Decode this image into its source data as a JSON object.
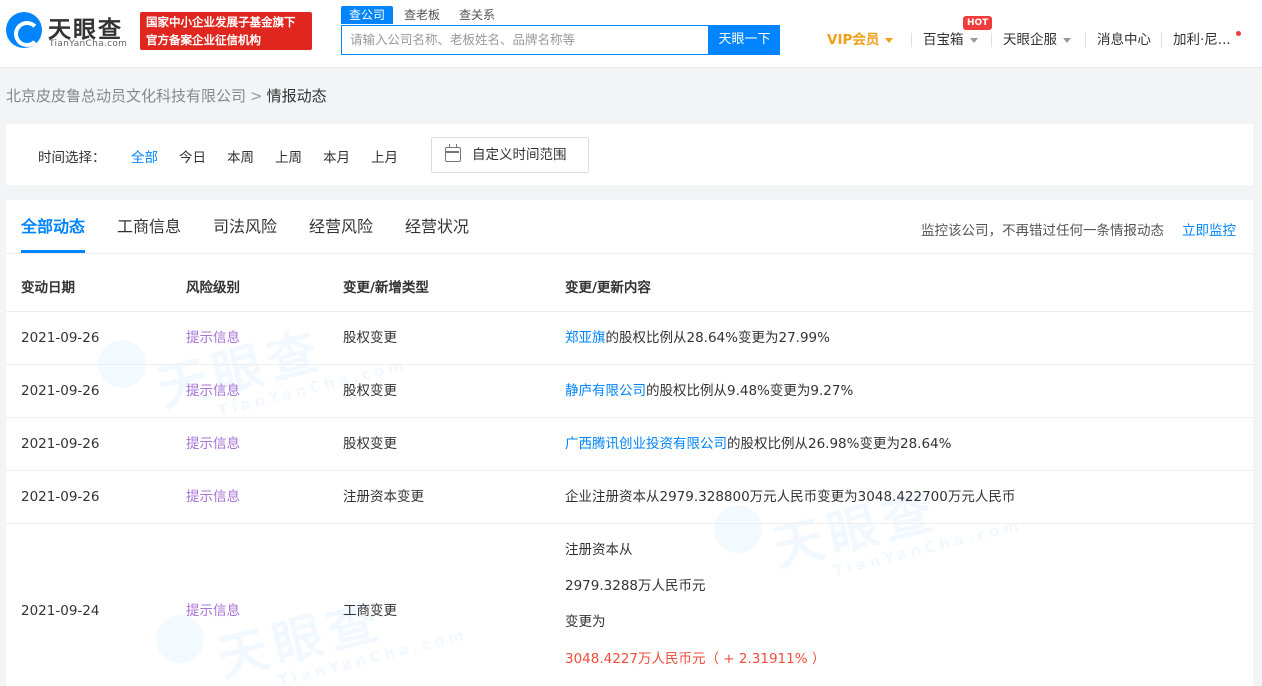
{
  "header": {
    "logo_text": "天眼查",
    "logo_sub": "TianYanCha.com",
    "badge_line1": "国家中小企业发展子基金旗下",
    "badge_line2": "官方备案企业征信机构",
    "search_tabs": [
      "查公司",
      "查老板",
      "查关系"
    ],
    "search_placeholder": "请输入公司名称、老板姓名、品牌名称等",
    "search_button": "天眼一下",
    "nav": {
      "vip": "VIP会员",
      "baibaoxiang": "百宝箱",
      "hot": "HOT",
      "qifu": "天眼企服",
      "messages": "消息中心",
      "user": "加利·尼..."
    }
  },
  "breadcrumb": {
    "company": "北京皮皮鲁总动员文化科技有限公司",
    "sep": ">",
    "current": "情报动态"
  },
  "filter": {
    "label": "时间选择：",
    "options": [
      "全部",
      "今日",
      "本周",
      "上周",
      "本月",
      "上月"
    ],
    "custom": "自定义时间范围"
  },
  "tabs": [
    "全部动态",
    "工商信息",
    "司法风险",
    "经营风险",
    "经营状况"
  ],
  "monitor": {
    "text": "监控该公司，不再错过任何一条情报动态",
    "link": "立即监控"
  },
  "table": {
    "headers": [
      "变动日期",
      "风险级别",
      "变更/新增类型",
      "变更/更新内容"
    ],
    "rows": [
      {
        "date": "2021-09-26",
        "risk": "提示信息",
        "type": "股权变更",
        "link": "郑亚旗",
        "rest": "的股权比例从28.64%变更为27.99%"
      },
      {
        "date": "2021-09-26",
        "risk": "提示信息",
        "type": "股权变更",
        "link": "静庐有限公司",
        "rest": "的股权比例从9.48%变更为9.27%"
      },
      {
        "date": "2021-09-26",
        "risk": "提示信息",
        "type": "股权变更",
        "link": "广西腾讯创业投资有限公司",
        "rest": "的股权比例从26.98%变更为28.64%"
      },
      {
        "date": "2021-09-26",
        "risk": "提示信息",
        "type": "注册资本变更",
        "link": "",
        "rest": "企业注册资本从2979.328800万元人民币变更为3048.422700万元人民币"
      }
    ],
    "last_row": {
      "date": "2021-09-24",
      "risk": "提示信息",
      "type": "工商变更",
      "line1": "注册资本从",
      "line2": "2979.3288万人民币元",
      "line3": "变更为",
      "line4": "3048.4227万人民币元（ + 2.31911% ）"
    }
  },
  "colors": {
    "accent": "#0084ff",
    "risk": "#a872d6",
    "vip": "#f29e19",
    "badge": "#e0271f",
    "increase": "#f04d3c"
  }
}
